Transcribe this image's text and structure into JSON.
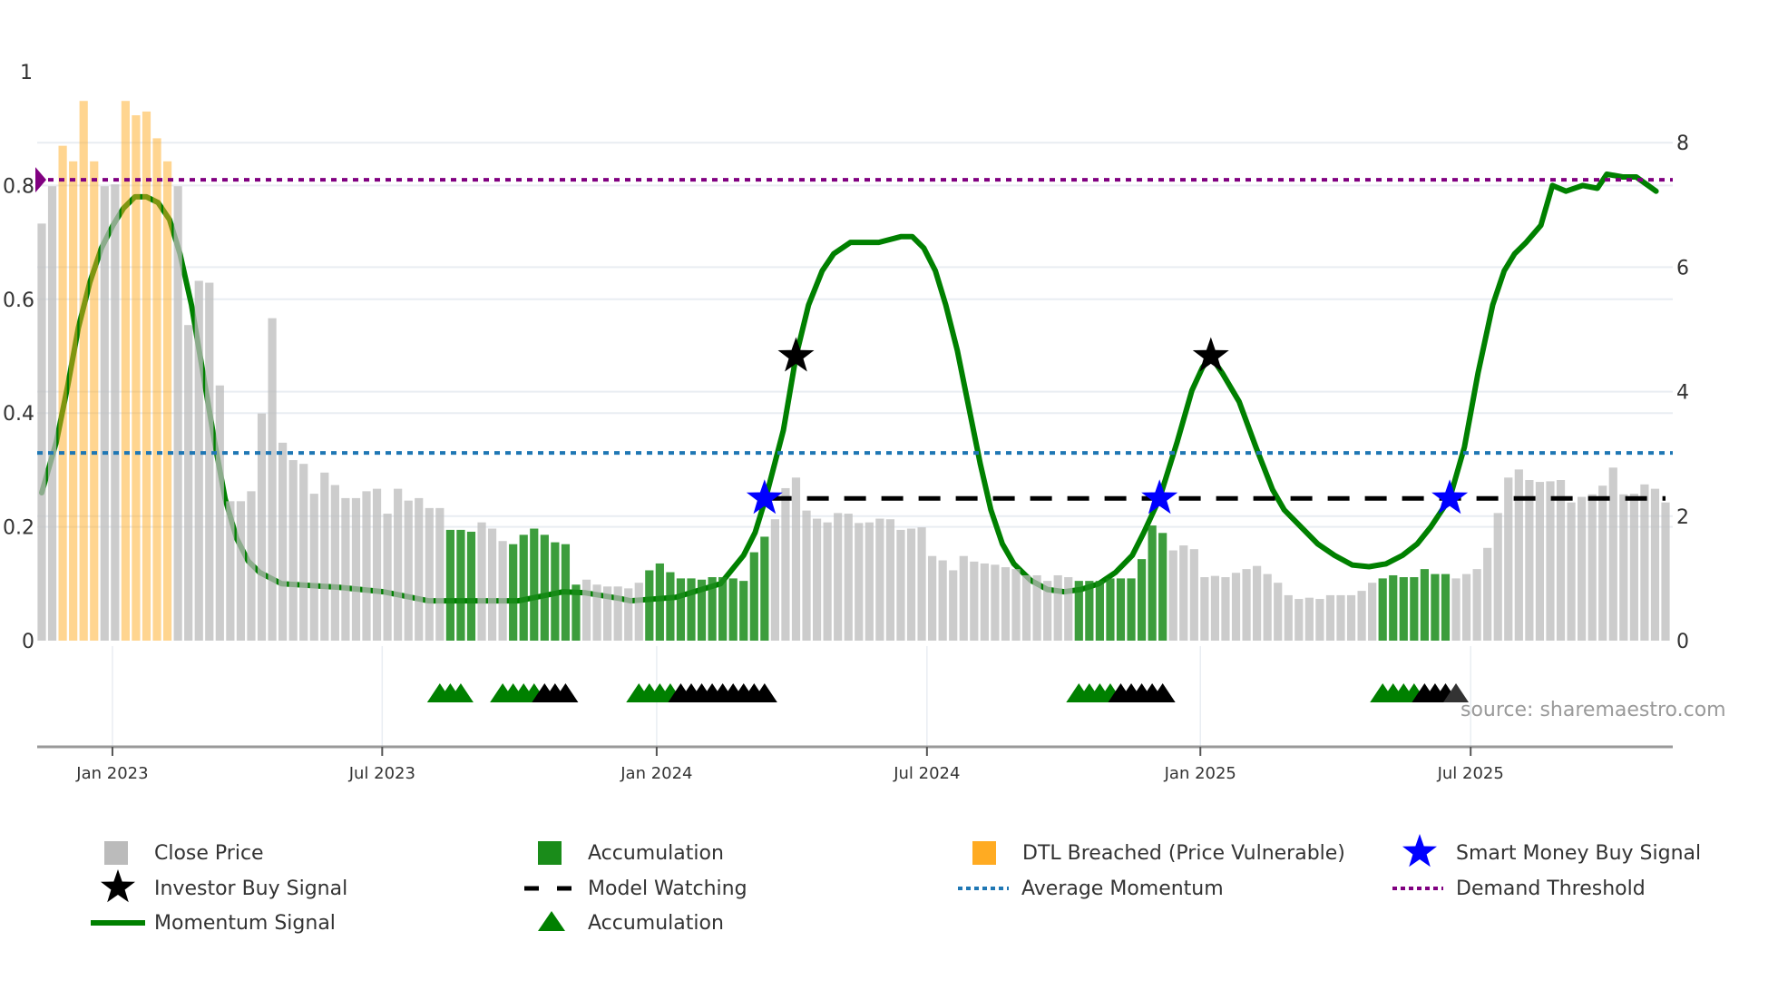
{
  "chart_data": {
    "type": "bar",
    "title": "",
    "x_unit": "week index",
    "left_axis": {
      "ylim": [
        0,
        1
      ],
      "ticks": [
        0,
        0.2,
        0.4,
        0.6,
        0.8,
        1
      ],
      "tick_labels": [
        "0",
        "0.2",
        "0.4",
        "0.6",
        "0.8",
        "1"
      ]
    },
    "right_axis": {
      "ylim": [
        0,
        9.1
      ],
      "ticks": [
        0,
        2,
        4,
        6,
        8
      ],
      "tick_labels": [
        "0",
        "2",
        "4",
        "6",
        "8"
      ]
    },
    "x_ticks": [
      {
        "label": "Jan 2023",
        "week": 6.75
      },
      {
        "label": "Jul 2023",
        "week": 32.5
      },
      {
        "label": "Jan 2024",
        "week": 58.7
      },
      {
        "label": "Jul 2024",
        "week": 84.5
      },
      {
        "label": "Jan 2025",
        "week": 110.6
      },
      {
        "label": "Jul 2025",
        "week": 136.4
      }
    ],
    "close_price": [
      6.7,
      7.3,
      7.95,
      7.7,
      8.67,
      7.7,
      7.3,
      7.33,
      8.67,
      8.44,
      8.5,
      8.07,
      7.7,
      7.3,
      5.07,
      5.78,
      5.75,
      4.1,
      2.24,
      2.24,
      2.4,
      3.65,
      5.18,
      3.18,
      2.9,
      2.84,
      2.36,
      2.7,
      2.5,
      2.29,
      2.29,
      2.4,
      2.44,
      2.04,
      2.44,
      2.25,
      2.29,
      2.13,
      2.13,
      1.78,
      1.78,
      1.75,
      1.9,
      1.8,
      1.6,
      1.55,
      1.7,
      1.8,
      1.7,
      1.58,
      1.55,
      0.9,
      0.98,
      0.9,
      0.87,
      0.87,
      0.84,
      0.93,
      1.13,
      1.24,
      1.1,
      1.0,
      1.0,
      0.98,
      1.02,
      1.02,
      1.0,
      0.96,
      1.42,
      1.67,
      1.95,
      2.45,
      2.62,
      2.09,
      1.96,
      1.9,
      2.05,
      2.04,
      1.89,
      1.9,
      1.96,
      1.95,
      1.78,
      1.8,
      1.82,
      1.36,
      1.29,
      1.13,
      1.36,
      1.27,
      1.24,
      1.22,
      1.18,
      1.15,
      1.05,
      1.05,
      0.96,
      1.05,
      1.02,
      0.96,
      0.96,
      0.96,
      1.0,
      1.0,
      1.0,
      1.31,
      1.85,
      1.73,
      1.45,
      1.53,
      1.47,
      1.02,
      1.04,
      1.02,
      1.09,
      1.15,
      1.2,
      1.07,
      0.93,
      0.73,
      0.67,
      0.69,
      0.67,
      0.73,
      0.73,
      0.73,
      0.8,
      0.93,
      1.0,
      1.05,
      1.02,
      1.02,
      1.15,
      1.07,
      1.07,
      1.0,
      1.07,
      1.15,
      1.49,
      2.05,
      2.62,
      2.75,
      2.58,
      2.55,
      2.56,
      2.58,
      2.22,
      2.31,
      2.35,
      2.49,
      2.78,
      2.35,
      2.36,
      2.51,
      2.44,
      2.22
    ],
    "dtl_breached_weeks": [
      2,
      3,
      4,
      5,
      8,
      9,
      10,
      11,
      12
    ],
    "accumulation_week_ranges": [
      [
        39,
        41
      ],
      [
        45,
        51
      ],
      [
        58,
        69
      ],
      [
        99,
        107
      ],
      [
        128,
        134
      ]
    ],
    "momentum_signal": [
      [
        0,
        0.26
      ],
      [
        1.4,
        0.35
      ],
      [
        2.5,
        0.45
      ],
      [
        3.5,
        0.55
      ],
      [
        4.6,
        0.63
      ],
      [
        5.7,
        0.69
      ],
      [
        6.8,
        0.73
      ],
      [
        7.8,
        0.76
      ],
      [
        8.9,
        0.78
      ],
      [
        10,
        0.78
      ],
      [
        11.1,
        0.77
      ],
      [
        12.2,
        0.74
      ],
      [
        13.2,
        0.68
      ],
      [
        14.3,
        0.59
      ],
      [
        15.4,
        0.47
      ],
      [
        16.5,
        0.35
      ],
      [
        17.5,
        0.25
      ],
      [
        18.6,
        0.18
      ],
      [
        19.7,
        0.14
      ],
      [
        20.8,
        0.12
      ],
      [
        22.9,
        0.1
      ],
      [
        28.3,
        0.094
      ],
      [
        32.6,
        0.086
      ],
      [
        36.9,
        0.07
      ],
      [
        45.5,
        0.07
      ],
      [
        49.8,
        0.086
      ],
      [
        51.9,
        0.084
      ],
      [
        55.2,
        0.074
      ],
      [
        56.2,
        0.07
      ],
      [
        60.5,
        0.076
      ],
      [
        64.8,
        0.1
      ],
      [
        67,
        0.15
      ],
      [
        68.1,
        0.19
      ],
      [
        69.1,
        0.25
      ],
      [
        70.8,
        0.37
      ],
      [
        72,
        0.5
      ],
      [
        73.2,
        0.59
      ],
      [
        74.5,
        0.65
      ],
      [
        75.6,
        0.68
      ],
      [
        77.2,
        0.7
      ],
      [
        79.9,
        0.7
      ],
      [
        82,
        0.71
      ],
      [
        83.1,
        0.71
      ],
      [
        84.2,
        0.69
      ],
      [
        85.3,
        0.65
      ],
      [
        86.3,
        0.59
      ],
      [
        87.4,
        0.51
      ],
      [
        88.5,
        0.41
      ],
      [
        89.6,
        0.31
      ],
      [
        90.6,
        0.23
      ],
      [
        91.7,
        0.17
      ],
      [
        92.8,
        0.135
      ],
      [
        94.4,
        0.106
      ],
      [
        96,
        0.09
      ],
      [
        97.6,
        0.086
      ],
      [
        99.2,
        0.09
      ],
      [
        100.9,
        0.1
      ],
      [
        102.5,
        0.12
      ],
      [
        104.1,
        0.15
      ],
      [
        105.2,
        0.19
      ],
      [
        106.7,
        0.25
      ],
      [
        108.4,
        0.35
      ],
      [
        109.8,
        0.44
      ],
      [
        110.8,
        0.48
      ],
      [
        111.6,
        0.5
      ],
      [
        112.7,
        0.47
      ],
      [
        114.3,
        0.42
      ],
      [
        115.9,
        0.34
      ],
      [
        117.5,
        0.265
      ],
      [
        118.6,
        0.23
      ],
      [
        120.2,
        0.2
      ],
      [
        121.8,
        0.17
      ],
      [
        123.4,
        0.15
      ],
      [
        125.1,
        0.133
      ],
      [
        126.7,
        0.13
      ],
      [
        128.3,
        0.135
      ],
      [
        129.9,
        0.15
      ],
      [
        131.3,
        0.17
      ],
      [
        132.6,
        0.2
      ],
      [
        134.4,
        0.25
      ],
      [
        135.8,
        0.34
      ],
      [
        137.1,
        0.47
      ],
      [
        138.5,
        0.59
      ],
      [
        139.6,
        0.65
      ],
      [
        140.6,
        0.68
      ],
      [
        141.7,
        0.7
      ],
      [
        143.1,
        0.73
      ],
      [
        144.2,
        0.8
      ],
      [
        145.5,
        0.79
      ],
      [
        147.1,
        0.8
      ],
      [
        148.5,
        0.795
      ],
      [
        149.4,
        0.82
      ],
      [
        150.9,
        0.815
      ],
      [
        152.2,
        0.815
      ],
      [
        154.1,
        0.79
      ]
    ],
    "average_momentum": 0.33,
    "demand_threshold": 0.81,
    "model_watching": {
      "level": 0.25,
      "from_week": 69.5,
      "to_week": 155
    },
    "smart_money_buy_signals": [
      [
        69,
        0.25
      ],
      [
        106.7,
        0.25
      ],
      [
        134.4,
        0.25
      ]
    ],
    "investor_buy_signals": [
      [
        72,
        0.5
      ],
      [
        111.6,
        0.5
      ]
    ],
    "accumulation_markers": {
      "green": [
        38,
        39,
        40,
        44,
        45,
        46,
        47,
        57,
        58,
        59,
        60,
        99,
        100,
        101,
        102,
        128,
        129,
        130,
        131
      ],
      "black": [
        48,
        49,
        50,
        61,
        62,
        63,
        64,
        65,
        66,
        67,
        68,
        69,
        103,
        104,
        105,
        106,
        107,
        132,
        133,
        134
      ],
      "dim": [
        135
      ]
    },
    "colors": {
      "close": "#bbbbbb",
      "accumulation": "#1a8c1a",
      "dtl": "#ffab22",
      "momentum": "#008000",
      "average": "#1f77b4",
      "demand": "#800080",
      "smart_money": "#0000ff",
      "investor": "#000000",
      "grid": "#e9edf2"
    },
    "legend": [
      {
        "label": "Close Price",
        "icon": "gray-square-icon"
      },
      {
        "label": "Accumulation",
        "icon": "green-square-icon"
      },
      {
        "label": "DTL Breached (Price Vulnerable)",
        "icon": "orange-square-icon"
      },
      {
        "label": "Smart Money Buy Signal",
        "icon": "blue-star-icon"
      },
      {
        "label": "Investor Buy Signal",
        "icon": "black-star-icon"
      },
      {
        "label": "Model Watching",
        "icon": "black-dash-icon"
      },
      {
        "label": "Average Momentum",
        "icon": "blue-dotted-line-icon"
      },
      {
        "label": "Demand Threshold",
        "icon": "purple-dotted-line-icon"
      },
      {
        "label": "Momentum Signal",
        "icon": "green-line-icon"
      },
      {
        "label": "Accumulation",
        "icon": "green-triangle-icon"
      }
    ],
    "source": "source: sharemaestro.com"
  }
}
